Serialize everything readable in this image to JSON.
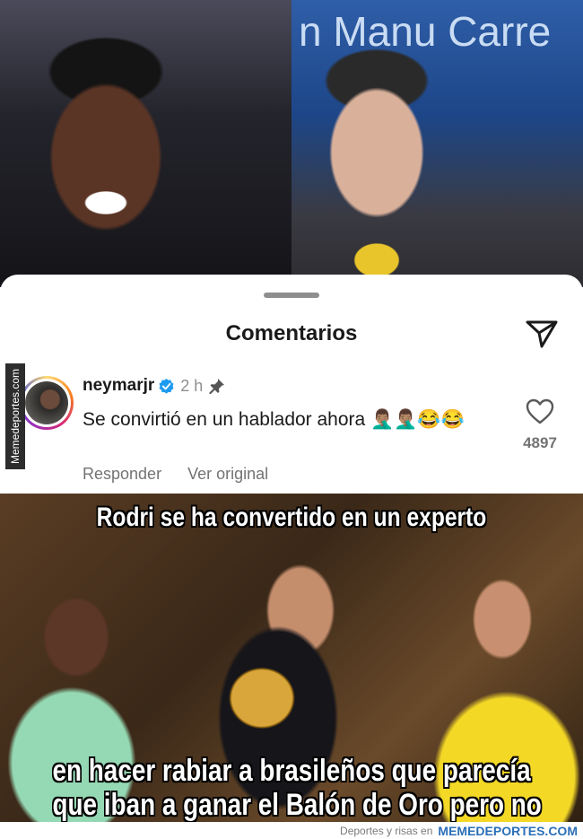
{
  "top_photos": {
    "studio_banner": "n Manu Carre"
  },
  "comments_sheet": {
    "title": "Comentarios",
    "comment": {
      "username": "neymarjr",
      "timestamp": "2 h",
      "text": "Se convirtió en un hablador ahora 🤦🏽‍♂️🤦🏽‍♂️😂😂",
      "like_count": "4897",
      "reply_label": "Responder",
      "see_original_label": "Ver original"
    },
    "side_watermark": "Memedeportes.com"
  },
  "meme": {
    "caption_top": "Rodri se ha convertido en un experto",
    "caption_bottom_line1": "en hacer rabiar a brasileños que parecía",
    "caption_bottom_line2": "que iban a ganar el Balón de Oro pero no"
  },
  "footer": {
    "prefix": "Deportes y risas en",
    "brand": "MEMEDEPORTES.COM"
  },
  "icons": {
    "share": "send-icon",
    "verified": "verified-badge-icon",
    "pinned": "pin-icon",
    "like": "heart-icon"
  },
  "colors": {
    "verified_blue": "#1d9bf0",
    "brand_blue": "#2a6fb7"
  }
}
